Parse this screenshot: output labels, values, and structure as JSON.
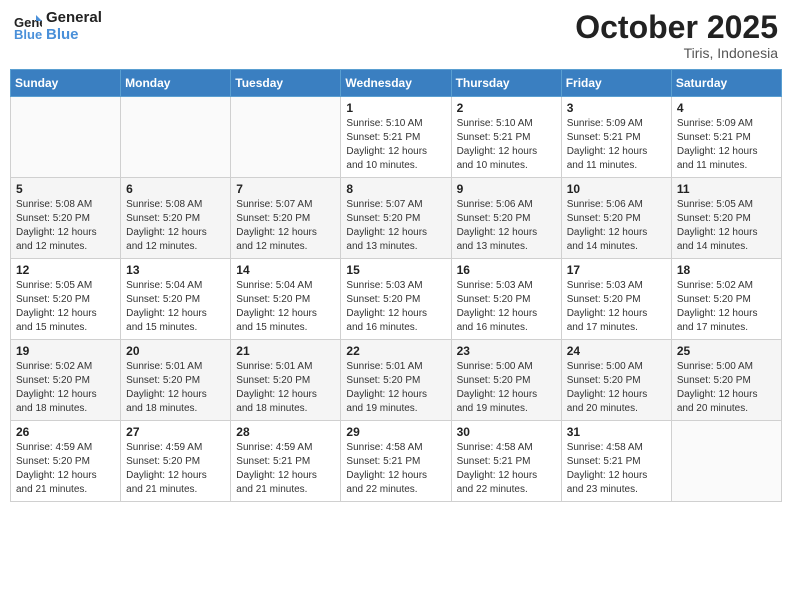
{
  "header": {
    "logo_line1": "General",
    "logo_line2": "Blue",
    "month": "October 2025",
    "location": "Tiris, Indonesia"
  },
  "days_of_week": [
    "Sunday",
    "Monday",
    "Tuesday",
    "Wednesday",
    "Thursday",
    "Friday",
    "Saturday"
  ],
  "weeks": [
    [
      {
        "num": "",
        "info": ""
      },
      {
        "num": "",
        "info": ""
      },
      {
        "num": "",
        "info": ""
      },
      {
        "num": "1",
        "info": "Sunrise: 5:10 AM\nSunset: 5:21 PM\nDaylight: 12 hours\nand 10 minutes."
      },
      {
        "num": "2",
        "info": "Sunrise: 5:10 AM\nSunset: 5:21 PM\nDaylight: 12 hours\nand 10 minutes."
      },
      {
        "num": "3",
        "info": "Sunrise: 5:09 AM\nSunset: 5:21 PM\nDaylight: 12 hours\nand 11 minutes."
      },
      {
        "num": "4",
        "info": "Sunrise: 5:09 AM\nSunset: 5:21 PM\nDaylight: 12 hours\nand 11 minutes."
      }
    ],
    [
      {
        "num": "5",
        "info": "Sunrise: 5:08 AM\nSunset: 5:20 PM\nDaylight: 12 hours\nand 12 minutes."
      },
      {
        "num": "6",
        "info": "Sunrise: 5:08 AM\nSunset: 5:20 PM\nDaylight: 12 hours\nand 12 minutes."
      },
      {
        "num": "7",
        "info": "Sunrise: 5:07 AM\nSunset: 5:20 PM\nDaylight: 12 hours\nand 12 minutes."
      },
      {
        "num": "8",
        "info": "Sunrise: 5:07 AM\nSunset: 5:20 PM\nDaylight: 12 hours\nand 13 minutes."
      },
      {
        "num": "9",
        "info": "Sunrise: 5:06 AM\nSunset: 5:20 PM\nDaylight: 12 hours\nand 13 minutes."
      },
      {
        "num": "10",
        "info": "Sunrise: 5:06 AM\nSunset: 5:20 PM\nDaylight: 12 hours\nand 14 minutes."
      },
      {
        "num": "11",
        "info": "Sunrise: 5:05 AM\nSunset: 5:20 PM\nDaylight: 12 hours\nand 14 minutes."
      }
    ],
    [
      {
        "num": "12",
        "info": "Sunrise: 5:05 AM\nSunset: 5:20 PM\nDaylight: 12 hours\nand 15 minutes."
      },
      {
        "num": "13",
        "info": "Sunrise: 5:04 AM\nSunset: 5:20 PM\nDaylight: 12 hours\nand 15 minutes."
      },
      {
        "num": "14",
        "info": "Sunrise: 5:04 AM\nSunset: 5:20 PM\nDaylight: 12 hours\nand 15 minutes."
      },
      {
        "num": "15",
        "info": "Sunrise: 5:03 AM\nSunset: 5:20 PM\nDaylight: 12 hours\nand 16 minutes."
      },
      {
        "num": "16",
        "info": "Sunrise: 5:03 AM\nSunset: 5:20 PM\nDaylight: 12 hours\nand 16 minutes."
      },
      {
        "num": "17",
        "info": "Sunrise: 5:03 AM\nSunset: 5:20 PM\nDaylight: 12 hours\nand 17 minutes."
      },
      {
        "num": "18",
        "info": "Sunrise: 5:02 AM\nSunset: 5:20 PM\nDaylight: 12 hours\nand 17 minutes."
      }
    ],
    [
      {
        "num": "19",
        "info": "Sunrise: 5:02 AM\nSunset: 5:20 PM\nDaylight: 12 hours\nand 18 minutes."
      },
      {
        "num": "20",
        "info": "Sunrise: 5:01 AM\nSunset: 5:20 PM\nDaylight: 12 hours\nand 18 minutes."
      },
      {
        "num": "21",
        "info": "Sunrise: 5:01 AM\nSunset: 5:20 PM\nDaylight: 12 hours\nand 18 minutes."
      },
      {
        "num": "22",
        "info": "Sunrise: 5:01 AM\nSunset: 5:20 PM\nDaylight: 12 hours\nand 19 minutes."
      },
      {
        "num": "23",
        "info": "Sunrise: 5:00 AM\nSunset: 5:20 PM\nDaylight: 12 hours\nand 19 minutes."
      },
      {
        "num": "24",
        "info": "Sunrise: 5:00 AM\nSunset: 5:20 PM\nDaylight: 12 hours\nand 20 minutes."
      },
      {
        "num": "25",
        "info": "Sunrise: 5:00 AM\nSunset: 5:20 PM\nDaylight: 12 hours\nand 20 minutes."
      }
    ],
    [
      {
        "num": "26",
        "info": "Sunrise: 4:59 AM\nSunset: 5:20 PM\nDaylight: 12 hours\nand 21 minutes."
      },
      {
        "num": "27",
        "info": "Sunrise: 4:59 AM\nSunset: 5:20 PM\nDaylight: 12 hours\nand 21 minutes."
      },
      {
        "num": "28",
        "info": "Sunrise: 4:59 AM\nSunset: 5:21 PM\nDaylight: 12 hours\nand 21 minutes."
      },
      {
        "num": "29",
        "info": "Sunrise: 4:58 AM\nSunset: 5:21 PM\nDaylight: 12 hours\nand 22 minutes."
      },
      {
        "num": "30",
        "info": "Sunrise: 4:58 AM\nSunset: 5:21 PM\nDaylight: 12 hours\nand 22 minutes."
      },
      {
        "num": "31",
        "info": "Sunrise: 4:58 AM\nSunset: 5:21 PM\nDaylight: 12 hours\nand 23 minutes."
      },
      {
        "num": "",
        "info": ""
      }
    ]
  ]
}
